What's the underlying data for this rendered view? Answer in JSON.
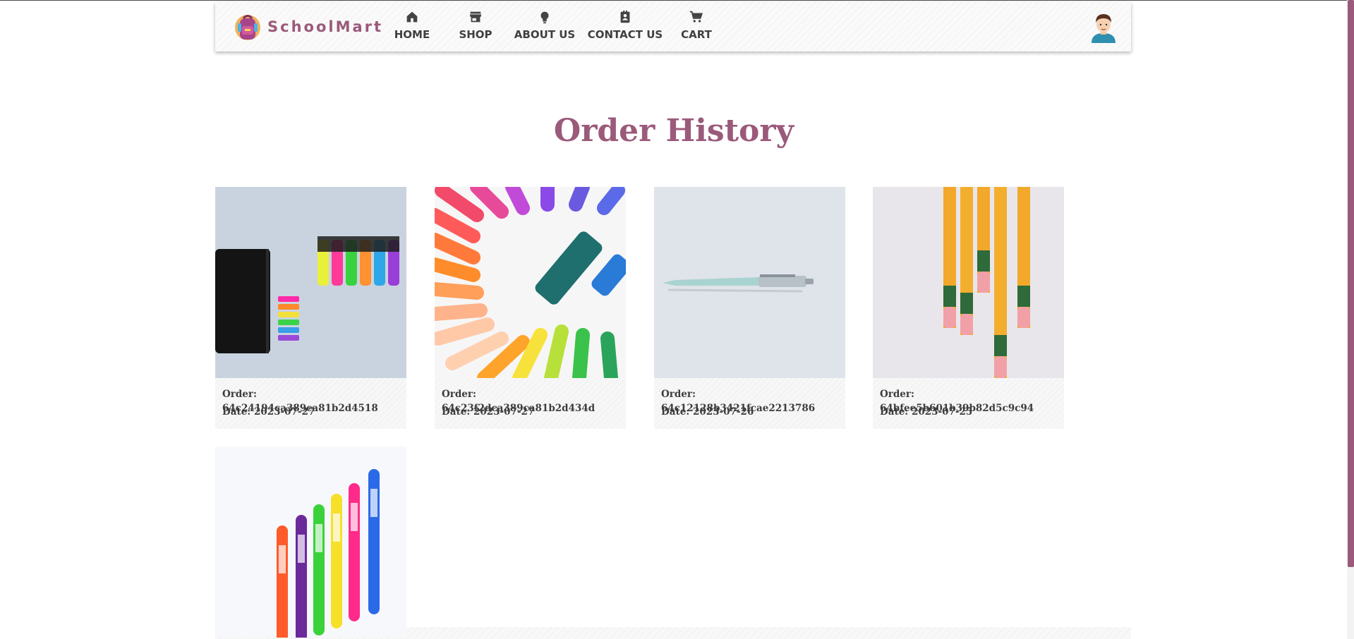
{
  "brand": {
    "name": "SchoolMart"
  },
  "nav": {
    "items": [
      {
        "label": "HOME",
        "icon": "home-icon"
      },
      {
        "label": "SHOP",
        "icon": "store-icon"
      },
      {
        "label": "ABOUT US",
        "icon": "lightbulb-icon"
      },
      {
        "label": "CONTACT US",
        "icon": "contact-card-icon"
      },
      {
        "label": "CART",
        "icon": "cart-icon"
      }
    ]
  },
  "page": {
    "title": "Order History"
  },
  "orders": [
    {
      "order_text": "Order: 64c24194ca389ca81b2d4518",
      "date_text": "Date: 2023-07-27",
      "image": "notebook-and-highlighters"
    },
    {
      "order_text": "Order: 64c23f2dca389ca81b2d434d",
      "date_text": "Date: 2023-07-27",
      "image": "crayons-circle"
    },
    {
      "order_text": "Order: 64c12128b3421fcae2213786",
      "date_text": "Date: 2023-07-26",
      "image": "pen"
    },
    {
      "order_text": "Order: 64bfee5b601b39b82d5c9c94",
      "date_text": "Date: 2023-07-25",
      "image": "pencils"
    },
    {
      "order_text": "",
      "date_text": "",
      "image": "gel-pens"
    }
  ],
  "colors": {
    "accent": "#9b5a7a",
    "text": "#3f3f3f"
  }
}
